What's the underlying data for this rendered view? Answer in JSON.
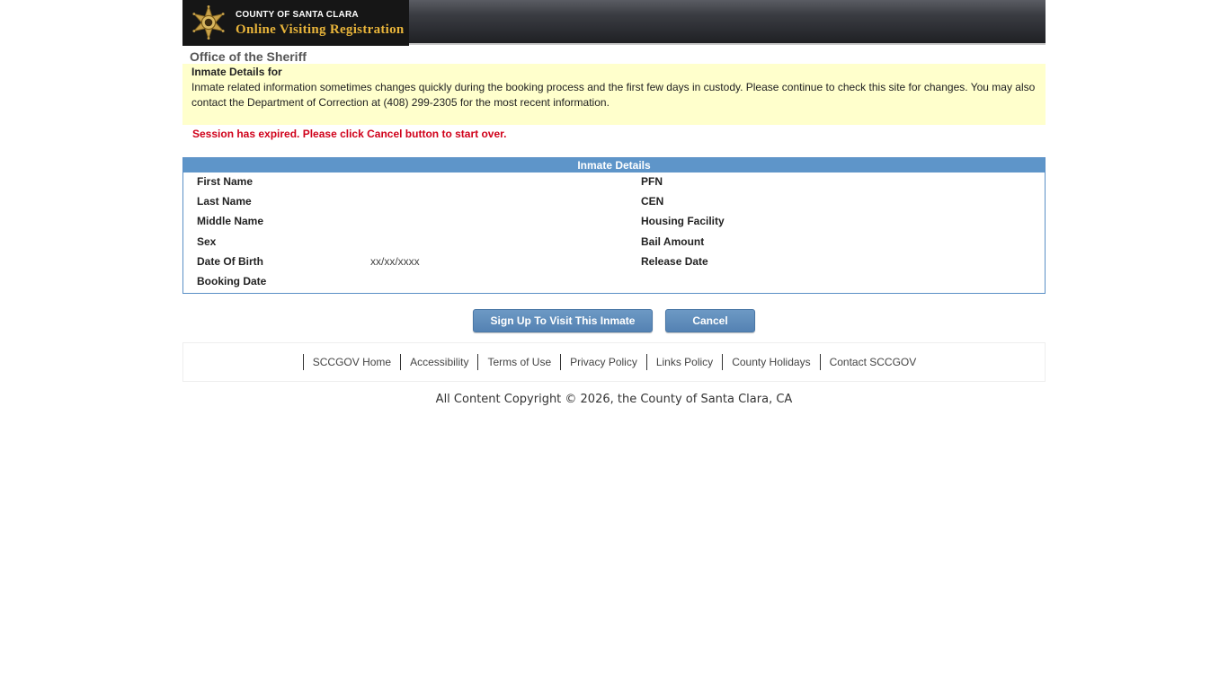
{
  "header": {
    "logo_line1": "COUNTY OF SANTA CLARA",
    "logo_line2": "Online Visiting Registration"
  },
  "office_title": "Office of the Sheriff",
  "notice": {
    "title": "Inmate Details for",
    "text": "Inmate related information sometimes changes quickly during the booking process and the first few days in custody. Please continue to check this site for changes. You may also contact the Department of Correction at (408) 299-2305 for the most recent information."
  },
  "error_message": "Session has expired. Please click Cancel button to start over.",
  "details": {
    "header": "Inmate Details",
    "left": [
      {
        "label": "First Name",
        "value": ""
      },
      {
        "label": "Last Name",
        "value": ""
      },
      {
        "label": "Middle Name",
        "value": ""
      },
      {
        "label": "Sex",
        "value": ""
      },
      {
        "label": "Date Of Birth",
        "value": "xx/xx/xxxx"
      },
      {
        "label": "Booking Date",
        "value": ""
      }
    ],
    "right": [
      {
        "label": "PFN",
        "value": ""
      },
      {
        "label": "CEN",
        "value": ""
      },
      {
        "label": "Housing Facility",
        "value": ""
      },
      {
        "label": "Bail Amount",
        "value": ""
      },
      {
        "label": "Release Date",
        "value": ""
      }
    ]
  },
  "buttons": {
    "signup": "Sign Up To Visit This Inmate",
    "cancel": "Cancel"
  },
  "footer": {
    "links": [
      "SCCGOV Home",
      "Accessibility",
      "Terms of Use",
      "Privacy Policy",
      "Links Policy",
      "County Holidays",
      "Contact SCCGOV"
    ],
    "copyright": "All Content Copyright © 2026, the County of Santa Clara, CA"
  },
  "colors": {
    "header_bar": "#5e95c9",
    "button": "#5e8cbc",
    "notice_bg": "#ffffcc",
    "error": "#d0021b",
    "logo_gold": "#e8b43a"
  }
}
